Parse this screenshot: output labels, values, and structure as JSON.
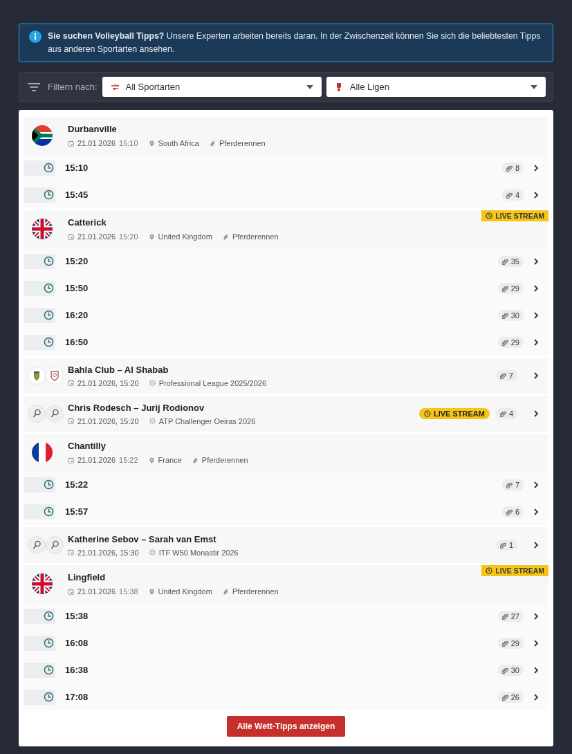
{
  "alert": {
    "text": "**Sie suchen Volleyball Tipps?** Unsere Experten arbeiten bereits daran. In der Zwischenzeit können Sie sich die beliebtesten Tipps aus anderen Sportarten ansehen."
  },
  "filter": {
    "label": "Filtern nach:",
    "sport_select": "All Sportarten",
    "league_select": "Alle Ligen"
  },
  "events": [
    {
      "kind": "race",
      "flag": {
        "kind": "za"
      },
      "name": "Durbanville",
      "date": "21.01.2026",
      "time": "15:10",
      "country": "South Africa",
      "sport": "Pferderennen",
      "races": [
        {
          "time": "15:10",
          "tips": "8"
        },
        {
          "time": "15:45",
          "tips": "4"
        }
      ]
    },
    {
      "kind": "race",
      "flag": {
        "kind": "gb"
      },
      "name": "Catterick",
      "date": "21.01.2026",
      "time": "15:20",
      "country": "United Kingdom",
      "sport": "Pferderennen",
      "live": "LIVE STREAM",
      "races": [
        {
          "time": "15:20",
          "tips": "35"
        },
        {
          "time": "15:50",
          "tips": "29"
        },
        {
          "time": "16:20",
          "tips": "30"
        },
        {
          "time": "16:50",
          "tips": "29"
        }
      ]
    },
    {
      "kind": "match",
      "icons": {
        "kind": "team"
      },
      "title": "Bahla Club – Al Shabab",
      "datetime": "21.01.2026, 15:20",
      "league": "Professional League 2025/2026",
      "tips": "7"
    },
    {
      "kind": "match",
      "icons": {
        "kind": "tennis"
      },
      "title": "Chris Rodesch – Jurij Rodionov",
      "datetime": "21.01.2026, 15:20",
      "league": "ATP Challenger Oeiras 2026",
      "live": "LIVE STREAM",
      "tips": "4"
    },
    {
      "kind": "race",
      "flag": {
        "kind": "fr"
      },
      "name": "Chantilly",
      "date": "21.01.2026",
      "time": "15:22",
      "country": "France",
      "sport": "Pferderennen",
      "races": [
        {
          "time": "15:22",
          "tips": "7"
        },
        {
          "time": "15:57",
          "tips": "6"
        }
      ]
    },
    {
      "kind": "match",
      "icons": {
        "kind": "tennis"
      },
      "title": "Katherine Sebov – Sarah van Emst",
      "datetime": "21.01.2026, 15:30",
      "league": "ITF W50 Monastir 2026",
      "tips": "1"
    },
    {
      "kind": "race",
      "flag": {
        "kind": "gb"
      },
      "name": "Lingfield",
      "date": "21.01.2026",
      "time": "15:38",
      "country": "United Kingdom",
      "sport": "Pferderennen",
      "live": "LIVE STREAM",
      "races": [
        {
          "time": "15:38",
          "tips": "27"
        },
        {
          "time": "16:08",
          "tips": "29"
        },
        {
          "time": "16:38",
          "tips": "30"
        },
        {
          "time": "17:08",
          "tips": "26"
        }
      ]
    }
  ],
  "show_all_button": "Alle Wett-Tipps anzeigen"
}
